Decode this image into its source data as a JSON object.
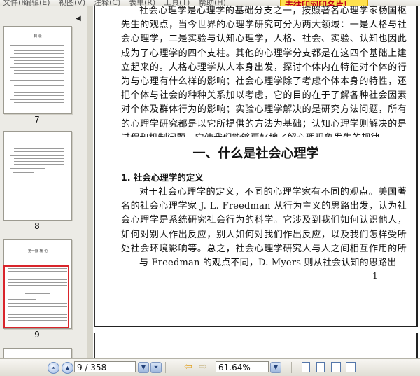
{
  "menu": {
    "items": [
      "文件(F)",
      "编辑(E)",
      "视图(V)",
      "注释(C)",
      "表单(R)",
      "工具(T)",
      "帮助(H)"
    ],
    "promo": "去往印网印名片!"
  },
  "thumbnails": [
    {
      "label": "7",
      "title": "目 录"
    },
    {
      "label": "8",
      "title": ""
    },
    {
      "label": "9",
      "title": "第一部  概  论"
    }
  ],
  "document": {
    "paragraph_1": "社会心理学是心理学的基础分支之一，按照著名心理学家杨国枢先生的观点，当今世界的心理学研究可分为两大领域：一是人格与社会心理学，二是实验与认知心理学，人格、社会、实验、认知也因此成为了心理学的四个支柱。其他的心理学分支都是在这四个基础上建立起来的。人格心理学从人本身出发，探讨个体内在特征对个体的行为与心理有什么样的影响；社会心理学除了考虑个体本身的特性，还把个体与社会的种种关系加以考虑，它的目的在于了解各种社会因素对个体及群体行为的影响；实验心理学解决的是研究方法问题，所有的心理学研究都是以它所提供的方法为基础；认知心理学则解决的是过程和机制问题，它使我们能够更好地了解心理现象发生的规律。",
    "section_title": "一、什么是社会心理学",
    "subsection_title": "1. 社会心理学的定义",
    "paragraph_2": "对于社会心理学的定义，不同的心理学家有不同的观点。美国著名的社会心理学家 J. L. Freedman 从行为主义的思路出发，认为社会心理学是系统研究社会行为的科学。它涉及到我们如何认识他人，如何对别人作出反应，别人如何对我们作出反应，以及我们怎样受所处社会环境影响等。总之，社会心理学研究人与人之间相互作用的所有领域，包括与社会现象直接相关的各种行为。",
    "paragraph_3": "与 Freedman 的观点不同，D. Myers 则从社会认知的思路出",
    "page_number": "1"
  },
  "status": {
    "page_field": "9 / 358",
    "zoom": "61.64%"
  }
}
